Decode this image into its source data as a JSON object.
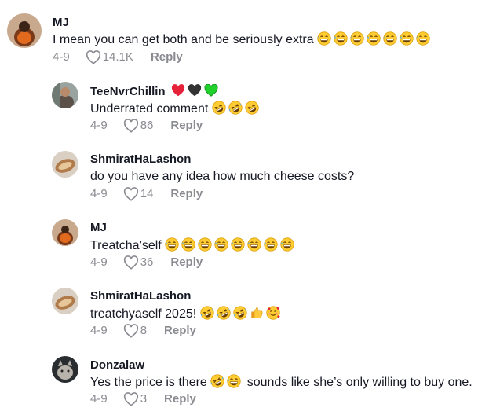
{
  "comments": [
    {
      "username": "MJ",
      "text": "I mean you can get both and be seriously extra",
      "emoji": [
        "grin-sweat",
        "grin-sweat",
        "grin-sweat",
        "grin-sweat",
        "grin-sweat",
        "grin-sweat",
        "grin-sweat"
      ],
      "date": "4-9",
      "likes": "14.1K",
      "reply": "Reply"
    },
    {
      "username": "TeeNvrChillin",
      "text": "Underrated comment",
      "emoji": [
        "rofl",
        "rofl",
        "rofl"
      ],
      "date": "4-9",
      "likes": "86",
      "reply": "Reply"
    },
    {
      "username": "ShmiratHaLashon",
      "text": "do you have any idea how much cheese costs?",
      "date": "4-9",
      "likes": "14",
      "reply": "Reply"
    },
    {
      "username": "MJ",
      "text": "Treatcha’self",
      "emoji": [
        "grin-sweat",
        "grin-sweat",
        "grin-sweat",
        "grin-sweat",
        "grin-sweat",
        "grin-sweat",
        "grin-sweat",
        "grin-sweat"
      ],
      "date": "4-9",
      "likes": "36",
      "reply": "Reply"
    },
    {
      "username": "ShmiratHaLashon",
      "text": "treatchyaself 2025!",
      "emoji": [
        "rofl",
        "rofl",
        "rofl",
        "thumbs-up",
        "smiling-hearts"
      ],
      "date": "4-9",
      "likes": "8",
      "reply": "Reply"
    },
    {
      "username": "Donzalaw",
      "text_before": "Yes the price is there",
      "emoji": [
        "rofl",
        "grin-sweat"
      ],
      "text_after": "sounds like she’s only willing to buy one.",
      "date": "4-9",
      "likes": "3",
      "reply": "Reply"
    }
  ],
  "colors": {
    "muted": "#8a8b91",
    "text": "#161823",
    "heart_red": "#e6213a",
    "heart_black": "#333333",
    "heart_green": "#1fd12a"
  },
  "icons": [
    "heart-outline-icon",
    "red-heart-icon",
    "black-heart-icon",
    "green-heart-icon"
  ]
}
